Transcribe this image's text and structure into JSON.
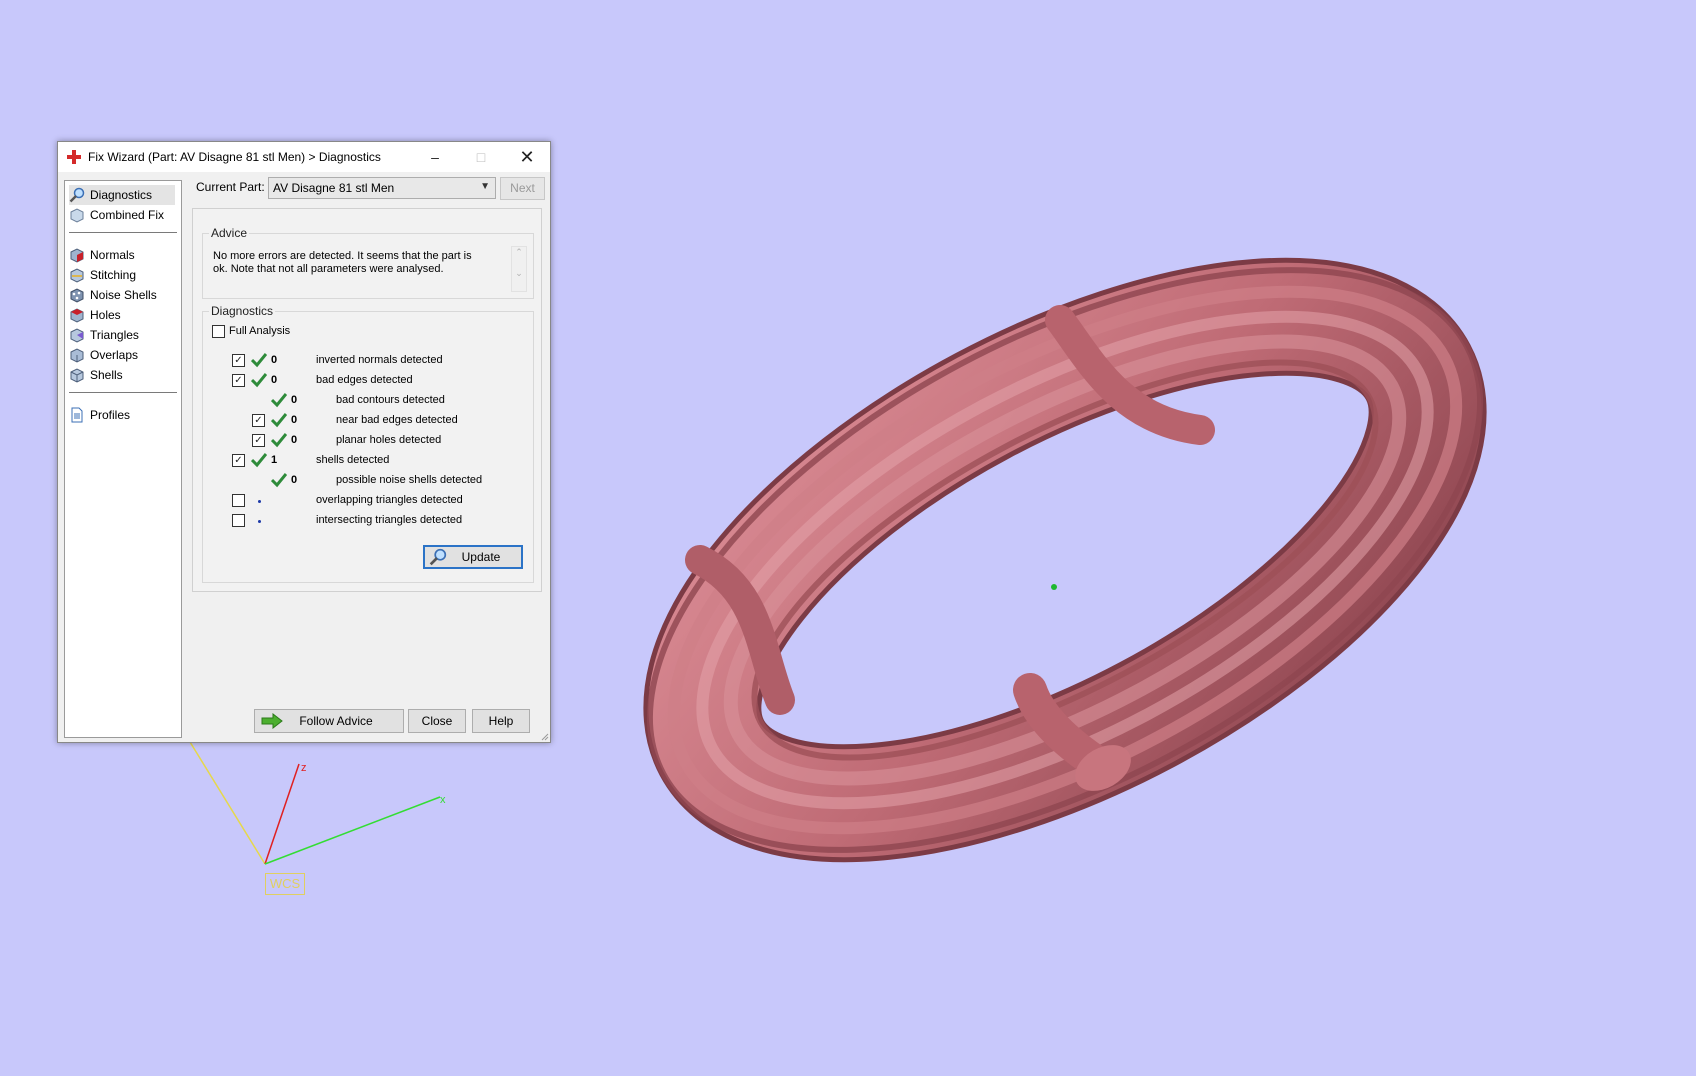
{
  "window": {
    "title": "Fix Wizard (Part: AV Disagne 81 stl  Men) > Diagnostics",
    "controls": {
      "minimize": "–",
      "maximize": "□",
      "close": "✕"
    }
  },
  "sidebar": {
    "group1": [
      {
        "label": "Diagnostics",
        "icon": "magnifier-icon",
        "selected": true
      },
      {
        "label": "Combined Fix",
        "icon": "cube-icon"
      }
    ],
    "group2": [
      {
        "label": "Normals",
        "icon": "normals-cube-icon"
      },
      {
        "label": "Stitching",
        "icon": "stitching-cube-icon"
      },
      {
        "label": "Noise Shells",
        "icon": "noise-shells-icon"
      },
      {
        "label": "Holes",
        "icon": "holes-cube-icon"
      },
      {
        "label": "Triangles",
        "icon": "triangles-cube-icon"
      },
      {
        "label": "Overlaps",
        "icon": "overlaps-cube-icon"
      },
      {
        "label": "Shells",
        "icon": "shells-cube-icon"
      }
    ],
    "group3": [
      {
        "label": "Profiles",
        "icon": "document-icon"
      }
    ]
  },
  "current_part": {
    "label": "Current Part:",
    "value": "AV Disagne 81 stl  Men",
    "next_label": "Next"
  },
  "advice": {
    "legend": "Advice",
    "text": "No more errors are detected. It seems that the part is ok. Note that not all parameters were analysed."
  },
  "diagnostics": {
    "legend": "Diagnostics",
    "full_analysis_label": "Full Analysis",
    "rows": [
      {
        "checked": true,
        "status": "ok",
        "count": "0",
        "text": "inverted normals detected"
      },
      {
        "checked": true,
        "status": "ok",
        "count": "0",
        "text": "bad edges detected"
      },
      {
        "checked": null,
        "status": "ok",
        "count": "0",
        "text": "bad contours detected"
      },
      {
        "checked": true,
        "status": "ok",
        "count": "0",
        "text": "near bad edges detected"
      },
      {
        "checked": true,
        "status": "ok",
        "count": "0",
        "text": "planar holes detected"
      },
      {
        "checked": true,
        "status": "ok",
        "count": "1",
        "text": "shells detected"
      },
      {
        "checked": null,
        "status": "ok",
        "count": "0",
        "text": "possible noise shells detected"
      },
      {
        "checked": false,
        "status": "pending",
        "count": "",
        "text": "overlapping triangles detected"
      },
      {
        "checked": false,
        "status": "pending",
        "count": "",
        "text": "intersecting triangles detected"
      }
    ],
    "update_label": "Update"
  },
  "footer": {
    "follow_advice_label": "Follow Advice",
    "close_label": "Close",
    "help_label": "Help"
  },
  "axes": {
    "z_label": "z",
    "x_label": "x",
    "wcs_label": "WCS"
  },
  "colors": {
    "background": "#c8c8fb",
    "model": "#c26f78",
    "ok_tick": "#2e8b3a",
    "x_axis": "#33dd33",
    "y_axis": "#e6d84a",
    "z_axis": "#e02020"
  }
}
